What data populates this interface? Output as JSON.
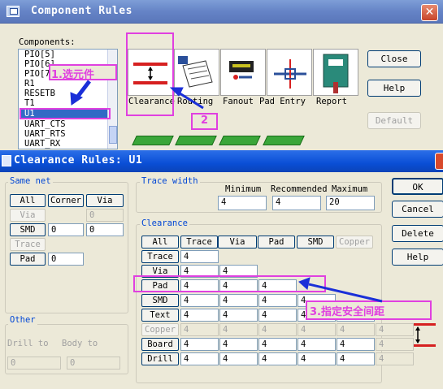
{
  "outer_window": {
    "title": "Component Rules",
    "components_label": "Components:",
    "components": [
      "PIO[5]",
      "PIO[6]",
      "PIO[7]",
      "R1",
      "RESETB",
      "T1",
      "U1",
      "UART_CTS",
      "UART_RTS",
      "UART_RX"
    ],
    "selected_component": "U1",
    "tools": [
      {
        "label": "Clearance",
        "icon": "clearance-icon"
      },
      {
        "label": "Routing",
        "icon": "routing-icon"
      },
      {
        "label": "Fanout",
        "icon": "fanout-icon"
      },
      {
        "label": "Pad Entry",
        "icon": "pad-entry-icon"
      },
      {
        "label": "Report",
        "icon": "report-icon"
      }
    ],
    "buttons": {
      "close": "Close",
      "help": "Help",
      "default": "Default"
    }
  },
  "inner_window": {
    "title": "Clearance Rules:  U1",
    "same_net": {
      "label": "Same net",
      "headers": [
        "All",
        "Corner",
        "Via"
      ],
      "via_label": "Via",
      "via_value": "0",
      "smd_label": "SMD",
      "smd_corner": "0",
      "smd_via": "0",
      "trace_label": "Trace",
      "pad_label": "Pad",
      "pad_value": "0"
    },
    "trace_width": {
      "label": "Trace width",
      "minimum_label": "Minimum",
      "recommended_label": "Recommended",
      "maximum_label": "Maximum",
      "minimum": "4",
      "recommended": "4",
      "maximum": "20"
    },
    "clearance": {
      "label": "Clearance",
      "columns": [
        "All",
        "Trace",
        "Via",
        "Pad",
        "SMD",
        "Copper"
      ],
      "rows": [
        {
          "label": "Trace",
          "values": [
            "4"
          ]
        },
        {
          "label": "Via",
          "values": [
            "4",
            "4"
          ]
        },
        {
          "label": "Pad",
          "values": [
            "4",
            "4",
            "4"
          ]
        },
        {
          "label": "SMD",
          "values": [
            "4",
            "4",
            "4",
            "4"
          ]
        },
        {
          "label": "Text",
          "values": [
            "4",
            "4",
            "4",
            "4",
            "4"
          ]
        },
        {
          "label": "Copper",
          "values": [
            "4",
            "4",
            "4",
            "4",
            "4",
            "4"
          ]
        },
        {
          "label": "Board",
          "values": [
            "4",
            "4",
            "4",
            "4",
            "4",
            "4"
          ]
        },
        {
          "label": "Drill",
          "values": [
            "4",
            "4",
            "4",
            "4",
            "4",
            "4"
          ]
        }
      ]
    },
    "other": {
      "label": "Other",
      "drill_to": "Drill to",
      "body_to": "Body to",
      "drill_value": "0",
      "body_value": "0"
    },
    "buttons": {
      "ok": "OK",
      "cancel": "Cancel",
      "delete": "Delete",
      "help": "Help"
    }
  },
  "annotations": {
    "step1": "1.选元件",
    "step2": "2",
    "step3": "3.指定安全间距"
  },
  "colors": {
    "annotation": "#e040e0",
    "arrow": "#1a2fd8",
    "selection": "#316ac5"
  }
}
